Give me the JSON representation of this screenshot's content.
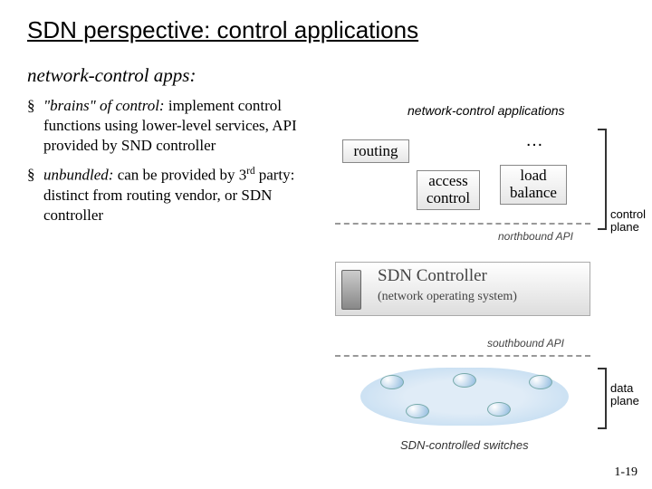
{
  "title": "SDN perspective: control applications",
  "subtitle": "network-control apps:",
  "bullets": [
    {
      "lead": "\"brains\" of control:",
      "rest": " implement control functions using lower-level services, API provided by SND controller"
    },
    {
      "lead": "unbundled:",
      "rest": " can be provided by 3",
      "sup": "rd",
      "tail": " party: distinct from routing vendor, or SDN controller"
    }
  ],
  "diagram": {
    "nca_label": "network-control applications",
    "dots": "…",
    "routing": "routing",
    "access_l1": "access",
    "access_l2": "control",
    "load_l1": "load",
    "load_l2": "balance",
    "nb_api": "northbound API",
    "sb_api": "southbound API",
    "controller_big": "SDN Controller",
    "controller_sub": "(network operating system)",
    "control_plane_l1": "control",
    "control_plane_l2": "plane",
    "data_plane_l1": "data",
    "data_plane_l2": "plane",
    "switches": "SDN-controlled switches"
  },
  "pagenum": "1-19"
}
